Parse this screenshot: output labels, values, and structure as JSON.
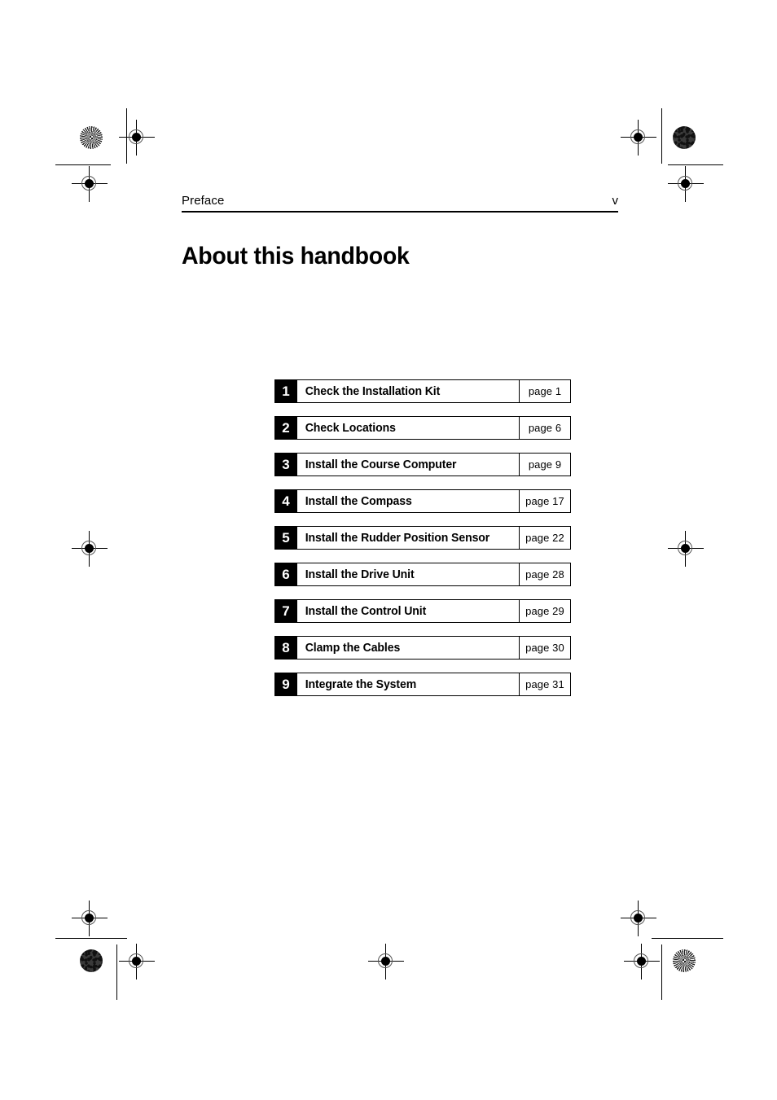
{
  "header": {
    "section_label": "Preface",
    "page_number": "v"
  },
  "title": "About this handbook",
  "steps": [
    {
      "number": "1",
      "label": "Check the Installation Kit",
      "page": "page 1"
    },
    {
      "number": "2",
      "label": "Check Locations",
      "page": "page 6"
    },
    {
      "number": "3",
      "label": "Install the Course Computer",
      "page": "page 9"
    },
    {
      "number": "4",
      "label": "Install the Compass",
      "page": "page 17"
    },
    {
      "number": "5",
      "label": "Install the Rudder Position Sensor",
      "page": "page 22"
    },
    {
      "number": "6",
      "label": "Install the Drive Unit",
      "page": "page 28"
    },
    {
      "number": "7",
      "label": "Install the Control Unit",
      "page": "page 29"
    },
    {
      "number": "8",
      "label": "Clamp the Cables",
      "page": "page 30"
    },
    {
      "number": "9",
      "label": "Integrate the System",
      "page": "page 31"
    }
  ],
  "colors": {
    "ink": "#000000",
    "paper": "#ffffff"
  }
}
